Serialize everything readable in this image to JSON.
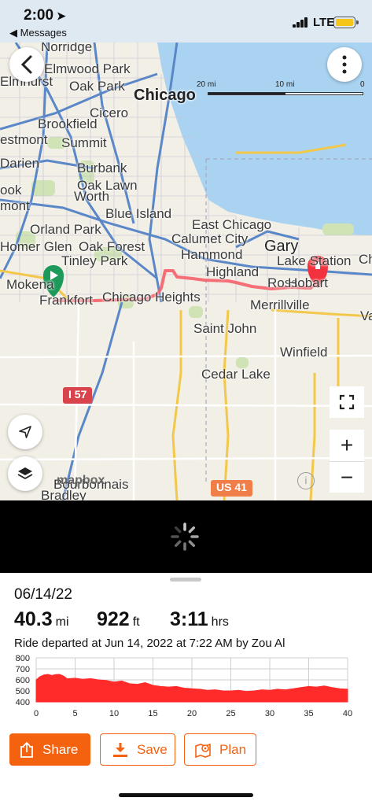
{
  "status_bar": {
    "time": "2:00",
    "back_app": "◀ Messages",
    "network": "LTE",
    "battery_color": "#f5c518"
  },
  "map": {
    "scale": {
      "left": "20 mi",
      "mid": "10 mi",
      "right": "0"
    },
    "labels": {
      "norridge": "Norridge",
      "elmwood_park": "Elmwood Park",
      "oak_park": "Oak Park",
      "elmhurst": "Elmhurst",
      "chicago": "Chicago",
      "cicero": "Cicero",
      "brookfield": "Brookfield",
      "westmont": "estmont",
      "summit": "Summit",
      "darien": "Darien",
      "burbank": "Burbank",
      "oak_lawn": "Oak Lawn",
      "worth": "Worth",
      "bolingbrook": "ook",
      "romeoville": "mont",
      "blue_island": "Blue Island",
      "east_chicago": "East Chicago",
      "calumet_city": "Calumet City",
      "orland_park": "Orland Park",
      "homer_glen": "Homer Glen",
      "oak_forest": "Oak Forest",
      "gary": "Gary",
      "lake_station": "Lake Station",
      "hammond": "Hammond",
      "tinley_park": "Tinley Park",
      "highland": "Highland",
      "mokena": "Mokena",
      "frankfort": "Frankfort",
      "chicago_heights": "Chicago Heights",
      "ross": "Ross",
      "hobart": "Hobart",
      "merrillville": "Merrillville",
      "valparaiso": "Va",
      "saint_john": "Saint John",
      "winfield": "Winfield",
      "cedar_lake": "Cedar Lake",
      "bradley": "Bradley",
      "bourbonnais": "Bourbonnais",
      "chesterton": "Ch"
    },
    "shields": {
      "i57": "I 57",
      "us41": "US 41"
    },
    "attribution": "mapbox",
    "colors": {
      "route": "#f4606a",
      "start": "#1d9a5a",
      "end": "#f2323e",
      "water": "#a9d3f1",
      "land": "#f2efe6",
      "highway": "#f3c84a"
    }
  },
  "ride": {
    "date": "06/14/22",
    "distance": "40.3",
    "distance_unit": "mi",
    "elevation": "922",
    "elevation_unit": "ft",
    "duration": "3:11",
    "duration_unit": "hrs",
    "departed_text": "Ride departed at Jun 14, 2022 at 7:22 AM by Zou Al"
  },
  "chart_data": {
    "type": "area",
    "color": "#ff2a2a",
    "xlim": [
      0,
      40
    ],
    "ylim": [
      400,
      800
    ],
    "x_ticks": [
      0,
      5,
      10,
      15,
      20,
      25,
      30,
      35,
      40
    ],
    "y_ticks": [
      400,
      500,
      600,
      700,
      800
    ],
    "grid": true,
    "x": [
      0,
      0.5,
      1,
      1.5,
      2,
      2.5,
      3,
      3.5,
      4,
      5,
      6,
      7,
      8,
      9,
      10,
      11,
      12,
      13,
      14,
      15,
      16,
      17,
      18,
      19,
      20,
      21,
      22,
      23,
      24,
      25,
      26,
      27,
      28,
      29,
      30,
      31,
      32,
      33,
      34,
      35,
      36,
      37,
      38,
      39,
      40
    ],
    "y": [
      600,
      630,
      645,
      650,
      640,
      648,
      650,
      635,
      610,
      615,
      605,
      612,
      600,
      595,
      580,
      590,
      565,
      560,
      575,
      550,
      540,
      535,
      540,
      525,
      520,
      515,
      505,
      510,
      500,
      500,
      505,
      495,
      500,
      510,
      505,
      515,
      510,
      520,
      530,
      540,
      535,
      545,
      530,
      520,
      515
    ]
  },
  "actions": {
    "share": "Share",
    "save": "Save",
    "plan": "Plan"
  }
}
